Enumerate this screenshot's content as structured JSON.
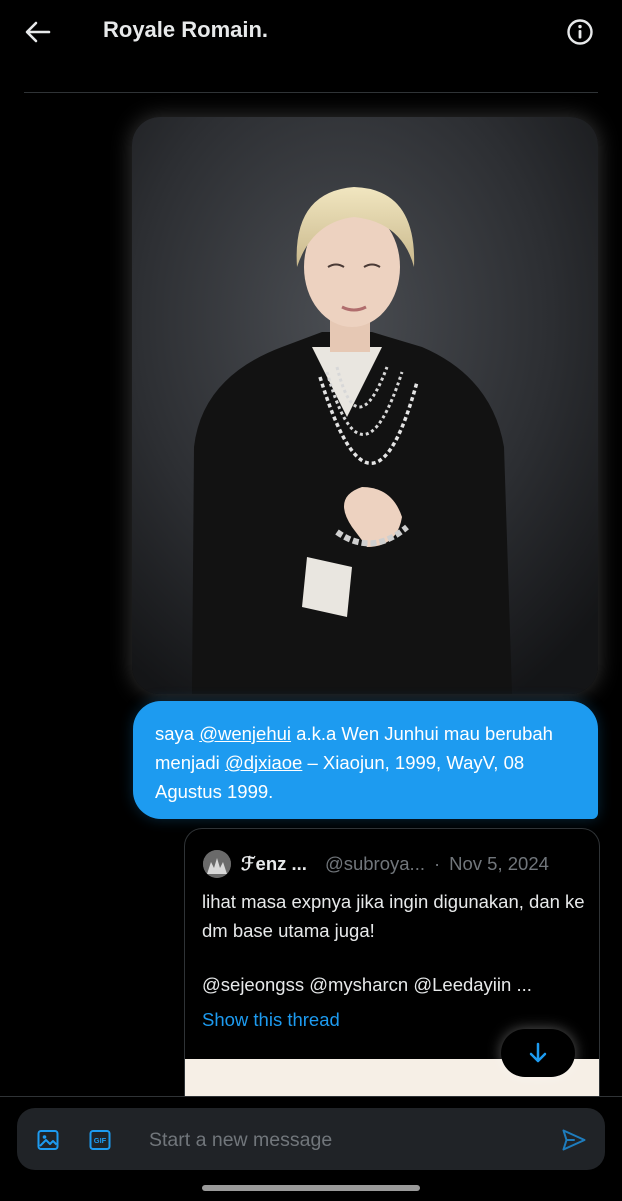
{
  "header": {
    "title": "Royale Romain.",
    "back_icon": "arrow-left-icon",
    "info_icon": "info-circle-icon"
  },
  "messages": {
    "photo_icon": "photo-message",
    "bubble": {
      "prefix": "saya ",
      "mention1": "@wenjehui",
      "middle": " a.k.a Wen Junhui mau berubah menjadi ",
      "mention2": "@djxiaoe",
      "suffix": " – Xiaojun, 1999, WayV, 08 Agustus 1999."
    }
  },
  "quoted": {
    "name": "ℱenz ...",
    "handle": "@subroya...",
    "separator": "·",
    "date": "Nov 5, 2024",
    "text": "lihat masa expnya jika ingin digunakan, dan ke dm base utama juga!",
    "mentions": "@sejeongss @mysharcn @Leedayiin ...",
    "show_thread": "Show this thread"
  },
  "composer": {
    "placeholder": "Start a new message",
    "media_icon": "image-icon",
    "gif_label": "GIF",
    "send_icon": "send-icon"
  },
  "colors": {
    "accent": "#1d9bf0",
    "background": "#000000",
    "composer_bg": "#202327",
    "muted": "#71767b"
  }
}
